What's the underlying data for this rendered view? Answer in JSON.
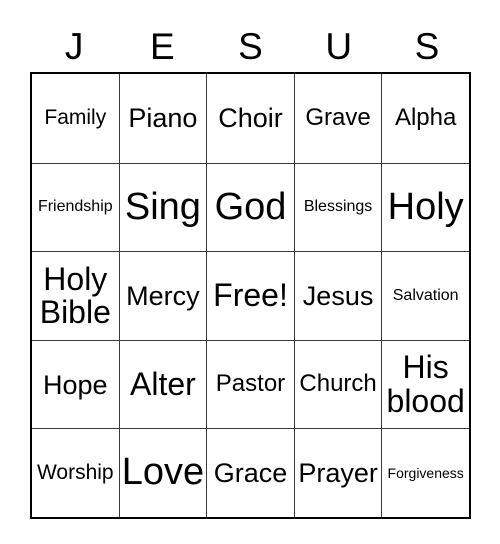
{
  "card": {
    "title_letters": [
      "J",
      "E",
      "S",
      "U",
      "S"
    ],
    "columns": 5,
    "rows": 5,
    "free_space": "Free!",
    "colors": {
      "background": "#ffffff",
      "text": "#000000",
      "outer_border": "#000000",
      "inner_border": "#3a3a3a"
    },
    "cells": [
      [
        {
          "label": "Family",
          "size": "fs-m"
        },
        {
          "label": "Piano",
          "size": "fs-l"
        },
        {
          "label": "Choir",
          "size": "fs-l"
        },
        {
          "label": "Grave",
          "size": "fs-ml"
        },
        {
          "label": "Alpha",
          "size": "fs-ml"
        }
      ],
      [
        {
          "label": "Friendship",
          "size": "fs-s"
        },
        {
          "label": "Sing",
          "size": "fs-xxl"
        },
        {
          "label": "God",
          "size": "fs-xxl"
        },
        {
          "label": "Blessings",
          "size": "fs-s"
        },
        {
          "label": "Holy",
          "size": "fs-xxl"
        }
      ],
      [
        {
          "label": "Holy\nBible",
          "size": "fs-xl"
        },
        {
          "label": "Mercy",
          "size": "fs-l"
        },
        {
          "label": "Free!",
          "size": "fs-xl"
        },
        {
          "label": "Jesus",
          "size": "fs-l"
        },
        {
          "label": "Salvation",
          "size": "fs-s"
        }
      ],
      [
        {
          "label": "Hope",
          "size": "fs-l"
        },
        {
          "label": "Alter",
          "size": "fs-xl"
        },
        {
          "label": "Pastor",
          "size": "fs-ml"
        },
        {
          "label": "Church",
          "size": "fs-ml"
        },
        {
          "label": "His\nblood",
          "size": "fs-xl"
        }
      ],
      [
        {
          "label": "Worship",
          "size": "fs-m"
        },
        {
          "label": "Love",
          "size": "fs-xxl"
        },
        {
          "label": "Grace",
          "size": "fs-l"
        },
        {
          "label": "Prayer",
          "size": "fs-l"
        },
        {
          "label": "Forgiveness",
          "size": "fs-xs"
        }
      ]
    ]
  }
}
